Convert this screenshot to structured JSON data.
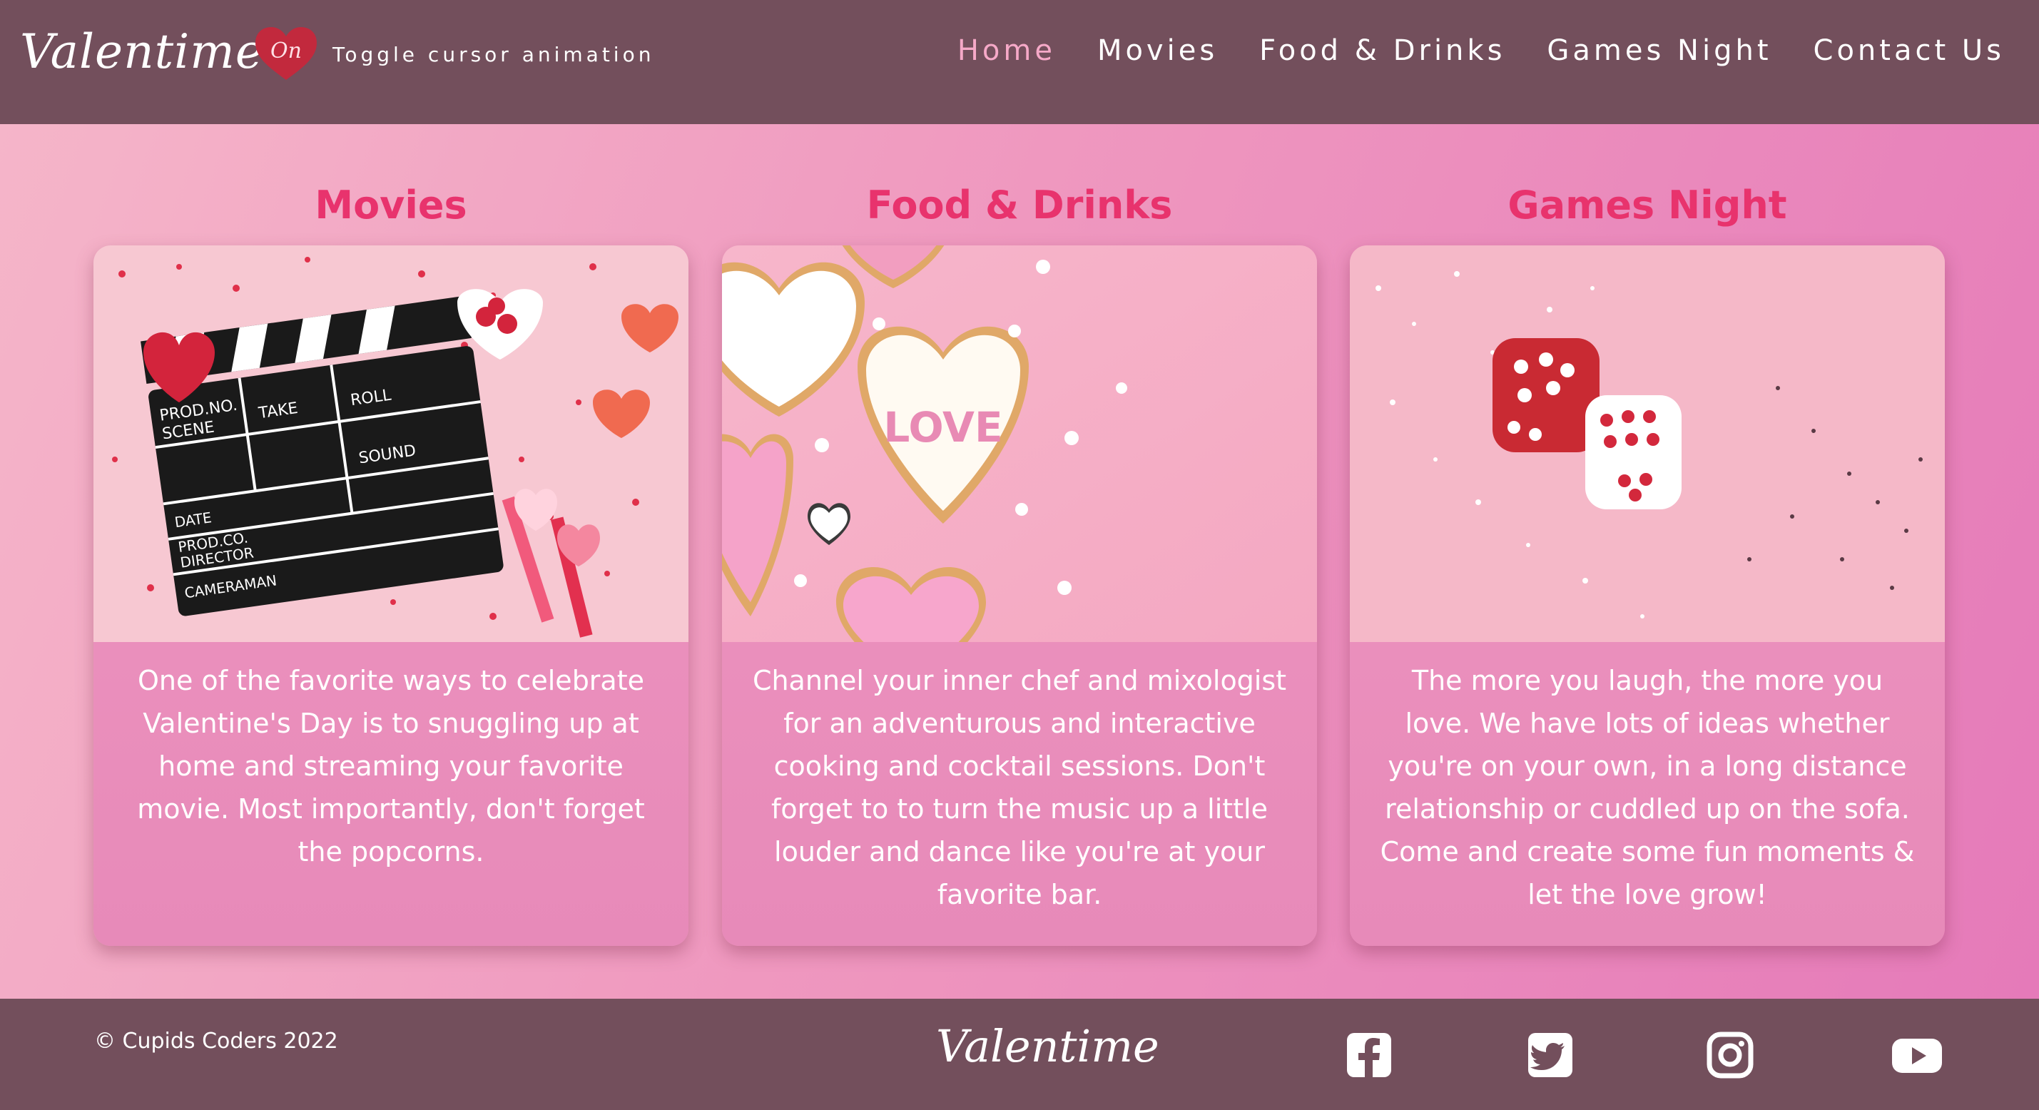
{
  "header": {
    "brand": "Valentime",
    "toggle_state": "On",
    "toggle_label": "Toggle cursor animation",
    "nav": [
      {
        "label": "Home",
        "active": true
      },
      {
        "label": "Movies",
        "active": false
      },
      {
        "label": "Food & Drinks",
        "active": false
      },
      {
        "label": "Games Night",
        "active": false
      },
      {
        "label": "Contact Us",
        "active": false
      }
    ]
  },
  "cards": [
    {
      "title": "Movies",
      "image_icon": "clapperboard-image",
      "clapper_labels": [
        "PROD.NO.",
        "SCENE",
        "TAKE",
        "ROLL",
        "SOUND",
        "DATE",
        "PROD.CO.",
        "DIRECTOR",
        "CAMERAMAN"
      ],
      "text": "One of the favorite ways to celebrate Valentine's Day is to snuggling up at home and streaming your favorite movie. Most importantly, don't forget the popcorns."
    },
    {
      "title": "Food & Drinks",
      "image_icon": "heart-cookies-image",
      "cookie_text": "LOVE",
      "text": "Channel your inner chef and mixologist for an adventurous and interactive cooking and cocktail sessions. Don't forget to to turn the music up a little louder and dance like you're at your favorite bar."
    },
    {
      "title": "Games Night",
      "image_icon": "heart-dice-image",
      "text": "The more you laugh, the more you love. We have lots of ideas whether you're on your own, in a long distance relationship or cuddled up on the sofa. Come and create some fun moments & let the love grow!"
    }
  ],
  "footer": {
    "copyright": "© Cupids Coders 2022",
    "brand": "Valentime",
    "social": [
      "facebook-icon",
      "twitter-icon",
      "instagram-icon",
      "youtube-icon"
    ]
  },
  "colors": {
    "nav_bg": "#734f5c",
    "accent_title": "#e8336d",
    "nav_active": "#f6a9c8",
    "card_bg": "#ec90bd"
  }
}
